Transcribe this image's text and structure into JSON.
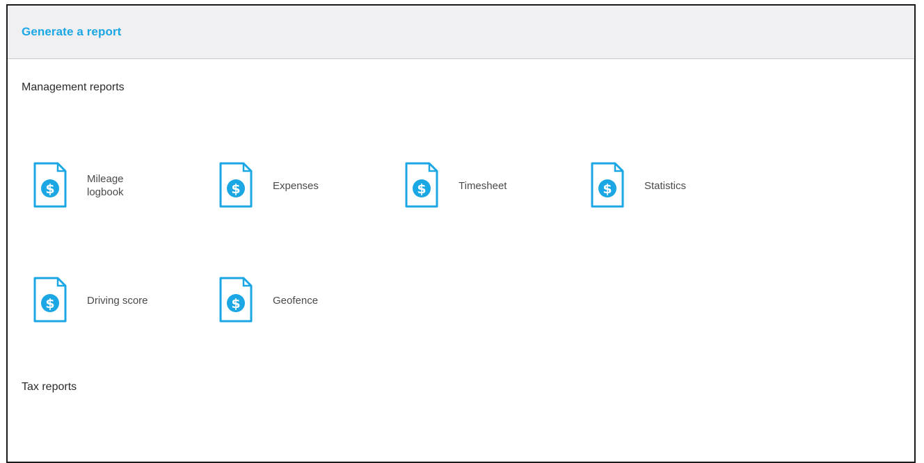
{
  "header": {
    "title": "Generate a report"
  },
  "sections": {
    "management": {
      "heading": "Management reports",
      "items": [
        {
          "label": "Mileage logbook",
          "icon": "dollar-document-icon"
        },
        {
          "label": "Expenses",
          "icon": "dollar-document-icon"
        },
        {
          "label": "Timesheet",
          "icon": "dollar-document-icon"
        },
        {
          "label": "Statistics",
          "icon": "dollar-document-icon"
        },
        {
          "label": "Driving score",
          "icon": "dollar-document-icon"
        },
        {
          "label": "Geofence",
          "icon": "dollar-document-icon"
        }
      ]
    },
    "tax": {
      "heading": "Tax reports"
    }
  },
  "colors": {
    "accent": "#1ba6e4",
    "header_bg": "#f0f0f2",
    "text": "#2b2b2b",
    "label": "#4a4a4a"
  }
}
